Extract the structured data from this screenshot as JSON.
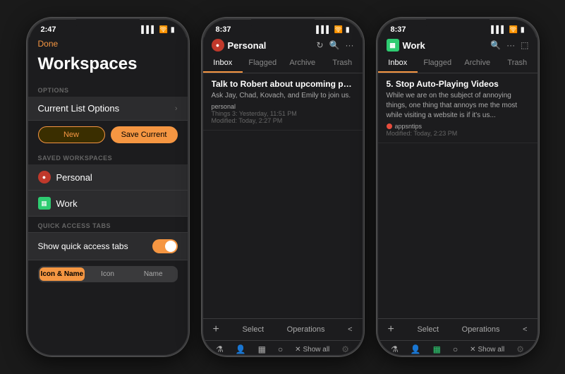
{
  "phone1": {
    "status_time": "2:47",
    "nav": {
      "done_label": "Done"
    },
    "title": "Workspaces",
    "options_section": "OPTIONS",
    "current_list_options": "Current List Options",
    "buttons": {
      "new_label": "New",
      "save_label": "Save Current"
    },
    "saved_workspaces_section": "SAVED WORKSPACES",
    "workspaces": [
      {
        "name": "Personal",
        "icon": "person",
        "type": "personal"
      },
      {
        "name": "Work",
        "icon": "grid",
        "type": "work"
      }
    ],
    "quick_access_section": "QUICK ACCESS TABS",
    "quick_access_label": "Show quick access tabs",
    "seg_options": [
      "Icon & Name",
      "Icon",
      "Name"
    ],
    "active_seg": 0
  },
  "phone2": {
    "status_time": "8:37",
    "workspace_name": "Personal",
    "header_icons": [
      "refresh",
      "search",
      "more"
    ],
    "tabs": [
      "Inbox",
      "Flagged",
      "Archive",
      "Trash"
    ],
    "active_tab": "Inbox",
    "emails": [
      {
        "subject": "Talk to Robert about upcoming party...",
        "preview": "Ask Jay, Chad, Kovach, and Emily to join us.",
        "tag": "personal",
        "meta1": "Things 3: Yesterday, 11:51 PM",
        "meta2": "Modified: Today, 2:27 PM"
      }
    ],
    "toolbar": {
      "plus": "+",
      "select": "Select",
      "operations": "Operations",
      "arrow": "<"
    },
    "filter_icons": [
      "funnel",
      "person",
      "grid",
      "circle"
    ],
    "show_all": "Show all"
  },
  "phone3": {
    "status_time": "8:37",
    "workspace_name": "Work",
    "workspace_icon": "grid",
    "header_icons": [
      "search",
      "more",
      "external"
    ],
    "tabs": [
      "Inbox",
      "Flagged",
      "Archive",
      "Trash"
    ],
    "active_tab": "Inbox",
    "emails": [
      {
        "subject": "5. Stop Auto-Playing Videos",
        "preview": "While we are on the subject of annoying things, one thing that annoys me the most while visiting a website is if it's us...",
        "tag": "appsntips",
        "meta": "Modified: Today, 2:23 PM"
      }
    ],
    "toolbar": {
      "plus": "+",
      "select": "Select",
      "operations": "Operations",
      "arrow": "<"
    },
    "filter_icons": [
      "funnel",
      "person",
      "grid",
      "circle"
    ],
    "show_all": "Show all"
  }
}
